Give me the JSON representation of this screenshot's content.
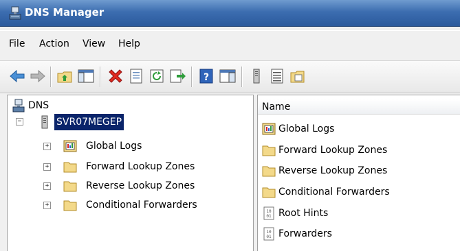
{
  "window": {
    "title": "DNS Manager"
  },
  "menu": [
    "File",
    "Action",
    "View",
    "Help"
  ],
  "toolbar": {
    "buttons": [
      "back-icon",
      "forward-icon",
      "up-folder-icon",
      "show-hide-console-tree-icon",
      "delete-icon",
      "properties-icon",
      "refresh-icon",
      "export-list-icon",
      "help-icon",
      "show-hide-action-pane-icon",
      "server-icon",
      "list-icon",
      "folder-properties-icon"
    ]
  },
  "tree": {
    "root": "DNS",
    "server": "SVR07MEGEP",
    "children": [
      "Global Logs",
      "Forward Lookup Zones",
      "Reverse Lookup Zones",
      "Conditional Forwarders"
    ]
  },
  "list": {
    "column": "Name",
    "items": [
      {
        "label": "Global Logs",
        "icon": "logs-icon"
      },
      {
        "label": "Forward Lookup Zones",
        "icon": "folder-icon"
      },
      {
        "label": "Reverse Lookup Zones",
        "icon": "folder-icon"
      },
      {
        "label": "Conditional Forwarders",
        "icon": "folder-icon"
      },
      {
        "label": "Root Hints",
        "icon": "binary-file-icon"
      },
      {
        "label": "Forwarders",
        "icon": "binary-file-icon"
      }
    ]
  },
  "colors": {
    "selection": "#0a246a",
    "titlebar": "#3c6db0",
    "folder": "#f3d98a"
  }
}
